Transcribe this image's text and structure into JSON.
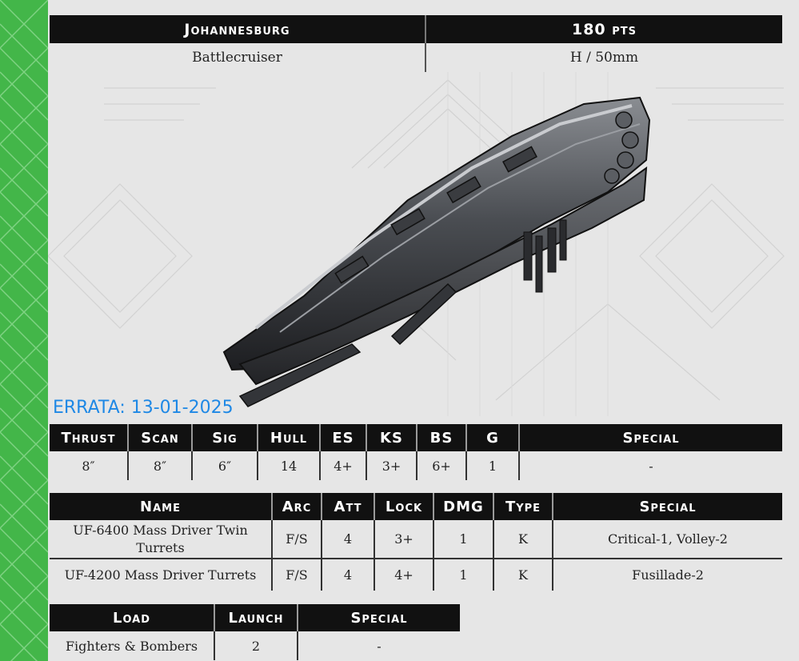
{
  "header": {
    "ship_name": "Johannesburg",
    "points": "180 pts",
    "ship_class": "Battlecruiser",
    "tonnage_base": "H / 50mm"
  },
  "errata": "ERRATA: 13-01-2025",
  "stats": {
    "headers": [
      "Thrust",
      "Scan",
      "Sig",
      "Hull",
      "ES",
      "KS",
      "BS",
      "G",
      "Special"
    ],
    "values": [
      "8″",
      "8″",
      "6″",
      "14",
      "4+",
      "3+",
      "6+",
      "1",
      "-"
    ]
  },
  "weapons": {
    "headers": [
      "Name",
      "Arc",
      "Att",
      "Lock",
      "DMG",
      "Type",
      "Special"
    ],
    "rows": [
      [
        "UF-6400 Mass Driver Twin Turrets",
        "F/S",
        "4",
        "3+",
        "1",
        "K",
        "Critical-1, Volley-2"
      ],
      [
        "UF-4200 Mass Driver Turrets",
        "F/S",
        "4",
        "4+",
        "1",
        "K",
        "Fusillade-2"
      ]
    ]
  },
  "launch": {
    "headers": [
      "Load",
      "Launch",
      "Special"
    ],
    "rows": [
      [
        "Fighters & Bombers",
        "2",
        "-"
      ]
    ]
  },
  "colors": {
    "accent_green": "#43b649",
    "header_black": "#111111",
    "errata_blue": "#1e88e5",
    "background": "#e4e4e4"
  }
}
